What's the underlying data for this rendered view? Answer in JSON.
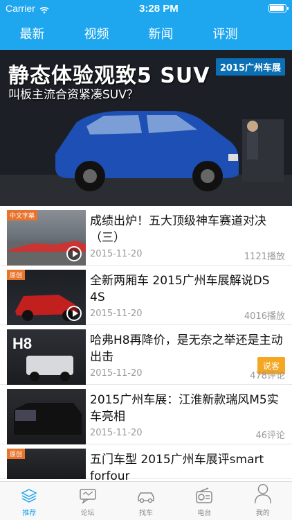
{
  "status": {
    "carrier": "Carrier",
    "time": "3:28 PM"
  },
  "tabs": [
    {
      "label": "最新",
      "active": true
    },
    {
      "label": "视频"
    },
    {
      "label": "新闻"
    },
    {
      "label": "评测"
    }
  ],
  "hero": {
    "title": "静态体验观致5 SUV",
    "subtitle": "叫板主流合资紧凑SUV？",
    "badge": "2015广州车展"
  },
  "list": [
    {
      "tag": "中文字幕",
      "title": "成绩出炉！五大顶级神车赛道对决（三）",
      "date": "2015-11-20",
      "stat": "1121播放",
      "play": true
    },
    {
      "tag": "原创",
      "title": "全新两厢车 2015广州车展解说DS 4S",
      "date": "2015-11-20",
      "stat": "4016播放",
      "play": true
    },
    {
      "tag": "",
      "title": "哈弗H8再降价，是无奈之举还是主动出击",
      "date": "2015-11-20",
      "stat": "478评论",
      "pill": "说客"
    },
    {
      "tag": "",
      "title": "2015广州车展：江淮新款瑞风M5实车亮相",
      "date": "2015-11-20",
      "stat": "46评论"
    },
    {
      "tag": "原创",
      "title": "五门车型 2015广州车展评smart forfour",
      "date": "",
      "stat": ""
    }
  ],
  "tabbar": [
    {
      "label": "推荐",
      "icon": "layers-icon",
      "active": true
    },
    {
      "label": "论坛",
      "icon": "chat-icon"
    },
    {
      "label": "找车",
      "icon": "car-icon"
    },
    {
      "label": "电台",
      "icon": "radio-icon"
    },
    {
      "label": "我的",
      "icon": "user-icon"
    }
  ],
  "colors": {
    "accent": "#1ea6ee",
    "muted": "#999999",
    "pill": "#f5a623"
  }
}
